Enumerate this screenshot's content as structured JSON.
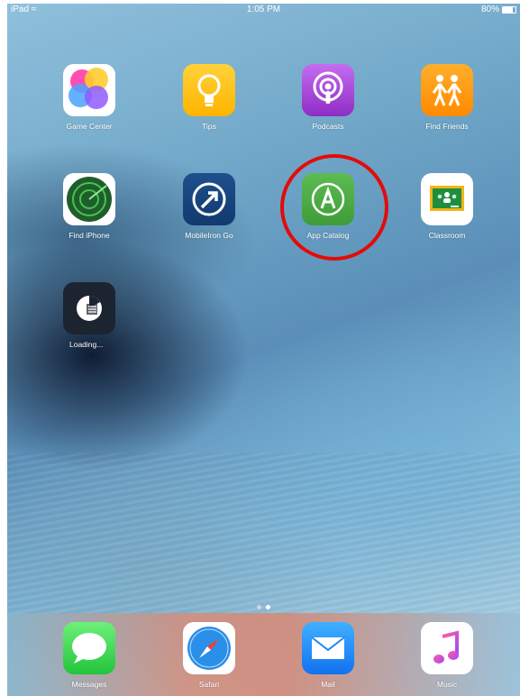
{
  "status_bar": {
    "device": "iPad",
    "time": "1:05 PM",
    "battery": "80%"
  },
  "apps": [
    {
      "label": "Game Center",
      "icon": "game-center-icon"
    },
    {
      "label": "Tips",
      "icon": "lightbulb-icon"
    },
    {
      "label": "Podcasts",
      "icon": "podcast-icon"
    },
    {
      "label": "Find Friends",
      "icon": "people-icon"
    },
    {
      "label": "Find iPhone",
      "icon": "radar-icon"
    },
    {
      "label": "MobileIron Go",
      "icon": "arrow-circle-icon"
    },
    {
      "label": "App Catalog",
      "icon": "app-catalog-icon"
    },
    {
      "label": "Classroom",
      "icon": "classroom-board-icon"
    },
    {
      "label": "Loading...",
      "icon": "loading-pie-icon"
    }
  ],
  "dock": [
    {
      "label": "Messages",
      "icon": "speech-bubble-icon"
    },
    {
      "label": "Safari",
      "icon": "compass-icon"
    },
    {
      "label": "Mail",
      "icon": "envelope-icon"
    },
    {
      "label": "Music",
      "icon": "music-note-icon"
    }
  ],
  "page_indicator": {
    "pages": 2,
    "current": 2
  },
  "highlight": {
    "target": "App Catalog",
    "color": "#e30b0b"
  }
}
